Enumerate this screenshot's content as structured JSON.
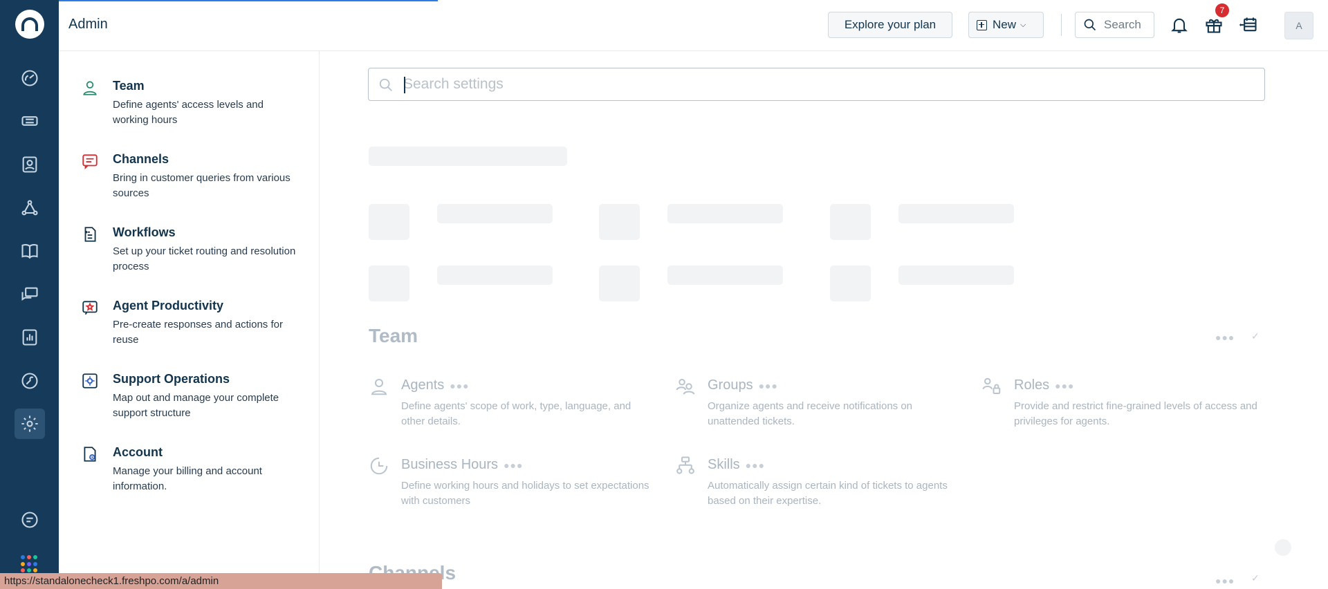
{
  "header": {
    "title": "Admin",
    "explore_label": "Explore your plan",
    "new_label": "New",
    "search_label": "Search",
    "gift_badge": "7",
    "avatar_initial": "A"
  },
  "rail": {
    "icons": [
      "dashboard-icon",
      "tickets-icon",
      "contacts-icon",
      "groups-icon",
      "solutions-icon",
      "forums-icon",
      "reports-icon",
      "tools-icon",
      "admin-gear-icon",
      "chat-icon"
    ],
    "apps_colors": [
      "#2c7be5",
      "#ff5d55",
      "#16c79a",
      "#f8ab1d",
      "#7d5cff",
      "#2c7be5",
      "#ff5d55",
      "#16c79a",
      "#f8ab1d"
    ]
  },
  "admin_nav": {
    "items": [
      {
        "title": "Team",
        "desc": "Define agents' access levels and working hours",
        "icon": "team-icon",
        "color": "#2b8a6e"
      },
      {
        "title": "Channels",
        "desc": "Bring in customer queries from various sources",
        "icon": "channels-icon",
        "color": "#d72d30"
      },
      {
        "title": "Workflows",
        "desc": "Set up your ticket routing and resolution process",
        "icon": "workflows-icon",
        "color": "#12344d"
      },
      {
        "title": "Agent Productivity",
        "desc": "Pre-create responses and actions for reuse",
        "icon": "agent-productivity-icon",
        "color": "#d72d30"
      },
      {
        "title": "Support Operations",
        "desc": "Map out and manage your complete support structure",
        "icon": "support-operations-icon",
        "color": "#2c5cc5"
      },
      {
        "title": "Account",
        "desc": "Manage your billing and account information.",
        "icon": "account-icon",
        "color": "#12344d"
      }
    ]
  },
  "main": {
    "search_placeholder": "Search settings",
    "team_section": {
      "title": "Team",
      "cards": [
        {
          "title": "Agents",
          "desc": "Define agents' scope of work, type, language, and other details."
        },
        {
          "title": "Groups",
          "desc": "Organize agents and receive notifications on unattended tickets."
        },
        {
          "title": "Roles",
          "desc": "Provide and restrict fine-grained levels of access and privileges for agents."
        },
        {
          "title": "Business Hours",
          "desc": "Define working hours and holidays to set expectations with customers"
        },
        {
          "title": "Skills",
          "desc": "Automatically assign certain kind of tickets to agents based on their expertise."
        }
      ]
    },
    "channels_section": {
      "title": "Channels"
    }
  },
  "status_bar": {
    "url": "https://standalonecheck1.freshpo.com/a/admin"
  }
}
